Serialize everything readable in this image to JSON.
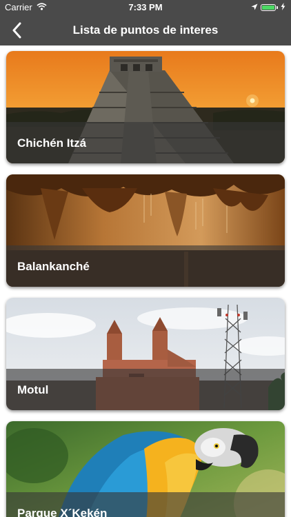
{
  "status_bar": {
    "carrier": "Carrier",
    "time": "7:33 PM",
    "icons": [
      "wifi-icon",
      "location-arrow-icon",
      "battery-icon",
      "charging-bolt-icon"
    ],
    "battery_color": "#4cd964"
  },
  "nav": {
    "title": "Lista de puntos de interes",
    "back_icon": "chevron-left-icon",
    "background": "#4a4a4a"
  },
  "places": [
    {
      "name": "Chichén Itzá"
    },
    {
      "name": "Balankanché"
    },
    {
      "name": "Motul"
    },
    {
      "name": "Parque X´Kekén"
    }
  ]
}
